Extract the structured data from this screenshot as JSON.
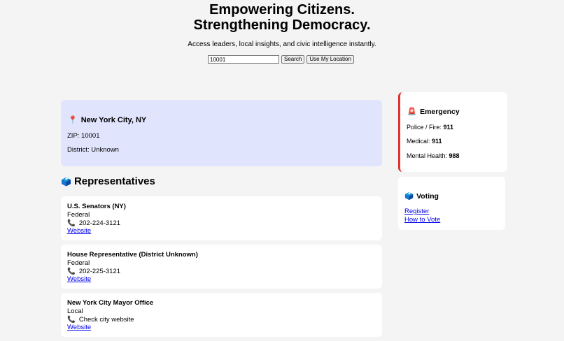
{
  "hero": {
    "title_line1": "Empowering Citizens.",
    "title_line2": "Strengthening Democracy.",
    "subtitle": "Access leaders, local insights, and civic intelligence instantly."
  },
  "search": {
    "value": "10001",
    "search_label": "Search",
    "location_label": "Use My Location"
  },
  "location": {
    "city": "New York City, NY",
    "zip": "ZIP: 10001",
    "district": "District: Unknown"
  },
  "representatives": {
    "heading": "Representatives",
    "items": [
      {
        "name": "U.S. Senators (NY)",
        "level": "Federal",
        "phone": "202-224-3121",
        "link": "Website"
      },
      {
        "name": "House Representative (District Unknown)",
        "level": "Federal",
        "phone": "202-225-3121",
        "link": "Website"
      },
      {
        "name": "New York City Mayor Office",
        "level": "Local",
        "phone": "Check city website",
        "link": "Website"
      }
    ]
  },
  "emergency": {
    "title": "Emergency",
    "lines": [
      {
        "label": "Police / Fire:",
        "value": "911"
      },
      {
        "label": "Medical:",
        "value": "911"
      },
      {
        "label": "Mental Health:",
        "value": "988"
      }
    ]
  },
  "voting": {
    "title": "Voting",
    "links": [
      "Register",
      "How to Vote"
    ]
  },
  "icons": {
    "location": "pin-icon",
    "representatives": "ballot-box-icon",
    "phone": "phone-icon",
    "emergency": "siren-icon",
    "voting": "ballot-icon"
  },
  "colors": {
    "background": "#f4f4f4",
    "location_card": "#e0e4fc",
    "emergency_accent": "#e03131",
    "link": "#0000ee",
    "phone_icon": "#c2185b"
  }
}
